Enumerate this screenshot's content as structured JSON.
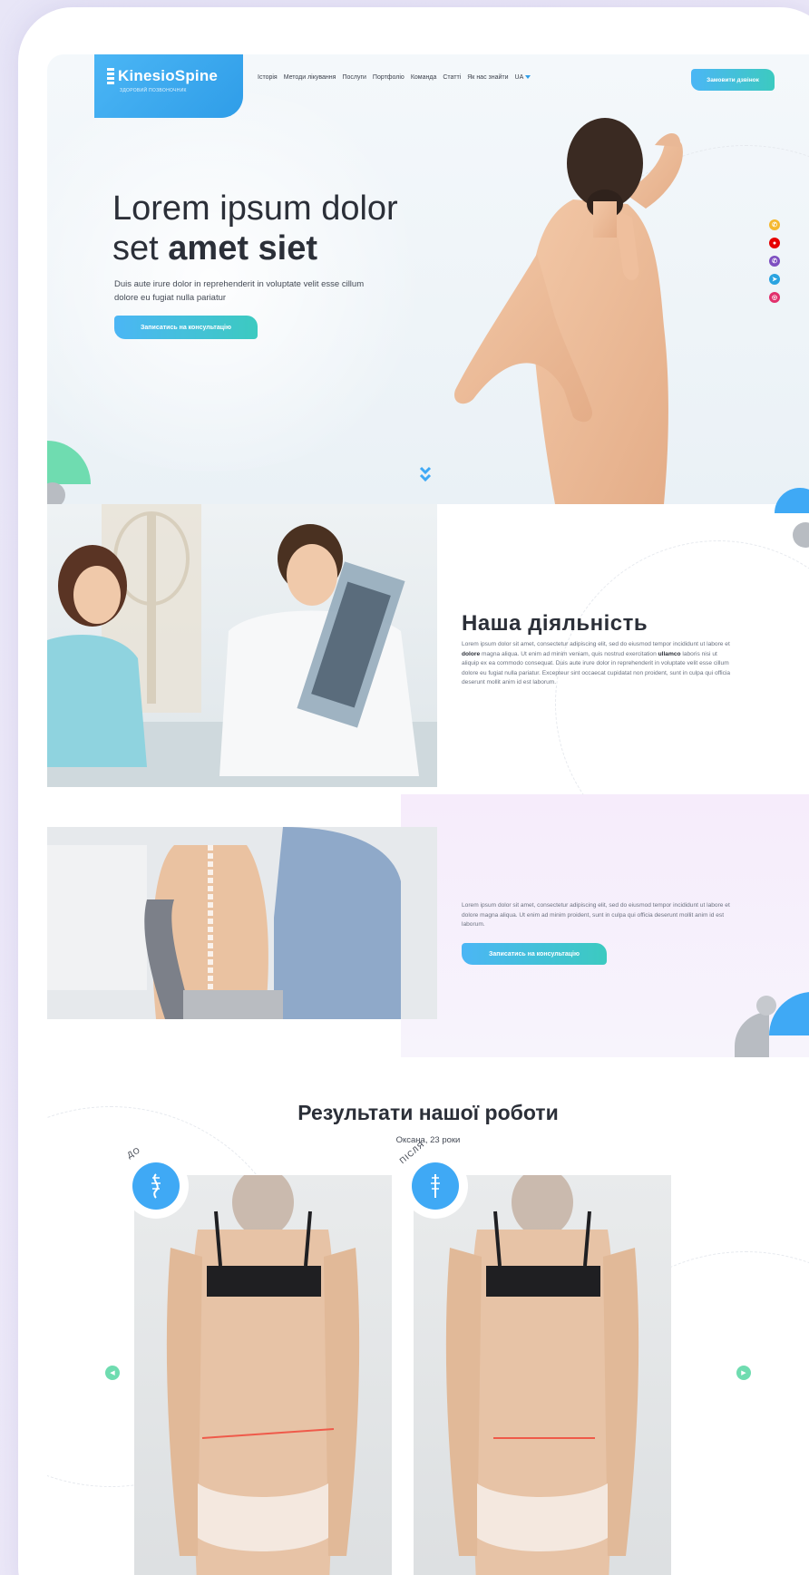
{
  "logo": {
    "name": "KinesioSpine",
    "tagline": "ЗДОРОВИЙ ПОЗВОНОЧНИК"
  },
  "nav": {
    "items": [
      "Історія",
      "Методи лікування",
      "Послуги",
      "Портфоліо",
      "Команда",
      "Статті",
      "Як нас знайти"
    ],
    "lang": "UA",
    "call_button": "Замовити дзвінок"
  },
  "hero": {
    "title_line1": "Lorem ipsum dolor",
    "title_line2_light": "set",
    "title_line2_bold": "amet siet",
    "subtitle": "Duis aute irure dolor in reprehenderit in voluptate velit esse cillum dolore eu fugiat nulla pariatur",
    "cta": "Записатись на консультацію"
  },
  "socials": [
    {
      "name": "viber-alt-icon",
      "color": "#f5b82e",
      "glyph": "✆"
    },
    {
      "name": "vodafone-icon",
      "color": "#e60000",
      "glyph": "●"
    },
    {
      "name": "viber-icon",
      "color": "#7d4fc1",
      "glyph": "✆"
    },
    {
      "name": "telegram-icon",
      "color": "#2aa3e0",
      "glyph": "➤"
    },
    {
      "name": "instagram-icon",
      "color": "#e1306c",
      "glyph": "◎"
    }
  ],
  "activity": {
    "title": "Наша діяльність",
    "text_a": "Lorem ipsum dolor sit amet, consectetur adipiscing elit, sed do eiusmod tempor incididunt ut labore et ",
    "text_b": "dolore",
    "text_c": " magna aliqua. Ut enim ad minim veniam, quis nostrud exercitation ",
    "text_d": "ullamco",
    "text_e": " laboris nisi ut aliquip ex ea commodo consequat. Duis aute irure dolor in reprehenderit in voluptate velit esse cillum dolore eu fugiat nulla pariatur. Excepteur sint occaecat cupidatat non proident, sunt in culpa qui officia deserunt mollit anim id est laborum."
  },
  "section3": {
    "text": "Lorem ipsum dolor sit amet, consectetur adipiscing elit, sed do eiusmod tempor incididunt ut labore et dolore magna aliqua. Ut enim ad minim proident, sunt in culpa qui officia deserunt mollit anim id est laborum.",
    "cta": "Записатись на консультацію"
  },
  "results": {
    "title": "Результати нашої роботи",
    "patient": "Оксана, 23 роки",
    "before_label": "ДО",
    "after_label": "ПІСЛЯ"
  },
  "colors": {
    "accent_blue": "#3fa9f5",
    "accent_green": "#6fdcb0",
    "text_dark": "#2b2f38"
  }
}
